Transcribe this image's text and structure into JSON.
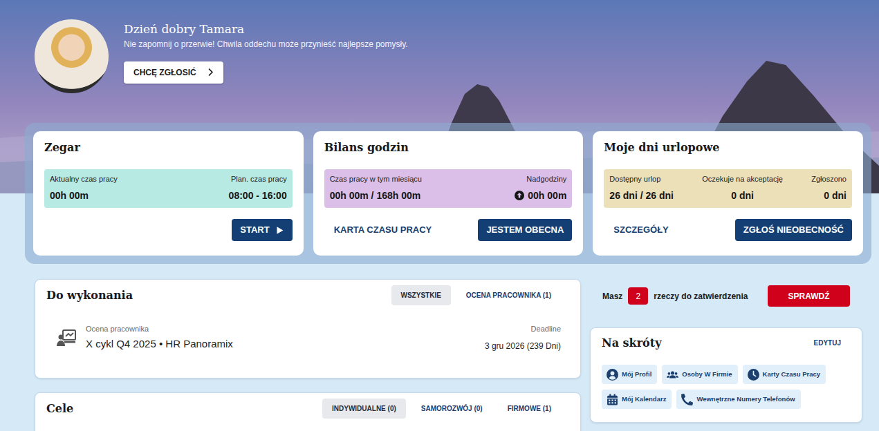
{
  "header": {
    "greeting": "Dzień dobry Tamara",
    "subtitle": "Nie zapomnij o przerwie! Chwila oddechu może przynieść najlepsze pomysły.",
    "report_button": "CHCĘ ZGŁOSIĆ"
  },
  "clock": {
    "title": "Zegar",
    "current_label": "Aktualny czas pracy",
    "current_value": "00h 00m",
    "plan_label": "Plan. czas pracy",
    "plan_value": "08:00 - 16:00",
    "start_button": "START"
  },
  "balance": {
    "title": "Bilans godzin",
    "month_label": "Czas pracy w tym miesiącu",
    "month_value": "00h 00m / 168h 00m",
    "overtime_label": "Nadgodziny",
    "overtime_value": "00h 00m",
    "timesheet_button": "KARTA CZASU PRACY",
    "present_button": "JESTEM OBECNA"
  },
  "vacation": {
    "title": "Moje dni urlopowe",
    "stats": [
      {
        "label": "Dostępny urlop",
        "value": "26 dni / 26 dni"
      },
      {
        "label": "Oczekuje na akceptację",
        "value": "0 dni"
      },
      {
        "label": "Zgłoszono",
        "value": "0 dni"
      }
    ],
    "details_button": "SZCZEGÓŁY",
    "absence_button": "ZGŁOŚ NIEOBECNOŚĆ"
  },
  "todo": {
    "title": "Do wykonania",
    "tabs": [
      {
        "label": "WSZYSTKIE",
        "selected": true
      },
      {
        "label": "OCENA PRACOWNIKA (1)",
        "selected": false
      }
    ],
    "items": [
      {
        "type": "Ocena pracownika",
        "name": "X cykl Q4 2025 • HR Panoramix",
        "deadline_label": "Deadline",
        "deadline": "3 gru 2026 (239 Dni)"
      }
    ]
  },
  "goals": {
    "title": "Cele",
    "tabs": [
      {
        "label": "INDYWIDUALNE (0)",
        "selected": true
      },
      {
        "label": "SAMOROZWÓJ (0)",
        "selected": false
      },
      {
        "label": "FIRMOWE (1)",
        "selected": false
      }
    ]
  },
  "approvals": {
    "prefix": "Masz",
    "count": "2",
    "suffix": "rzeczy do zatwierdzenia",
    "button": "SPRAWDŹ"
  },
  "shortcuts": {
    "title": "Na skróty",
    "edit": "EDYTUJ",
    "items": [
      {
        "label": "Mój Profil"
      },
      {
        "label": "Osoby W Firmie"
      },
      {
        "label": "Karty Czasu Pracy"
      },
      {
        "label": "Mój Kalendarz"
      },
      {
        "label": "Wewnętrzne Numery Telefonów"
      }
    ]
  }
}
